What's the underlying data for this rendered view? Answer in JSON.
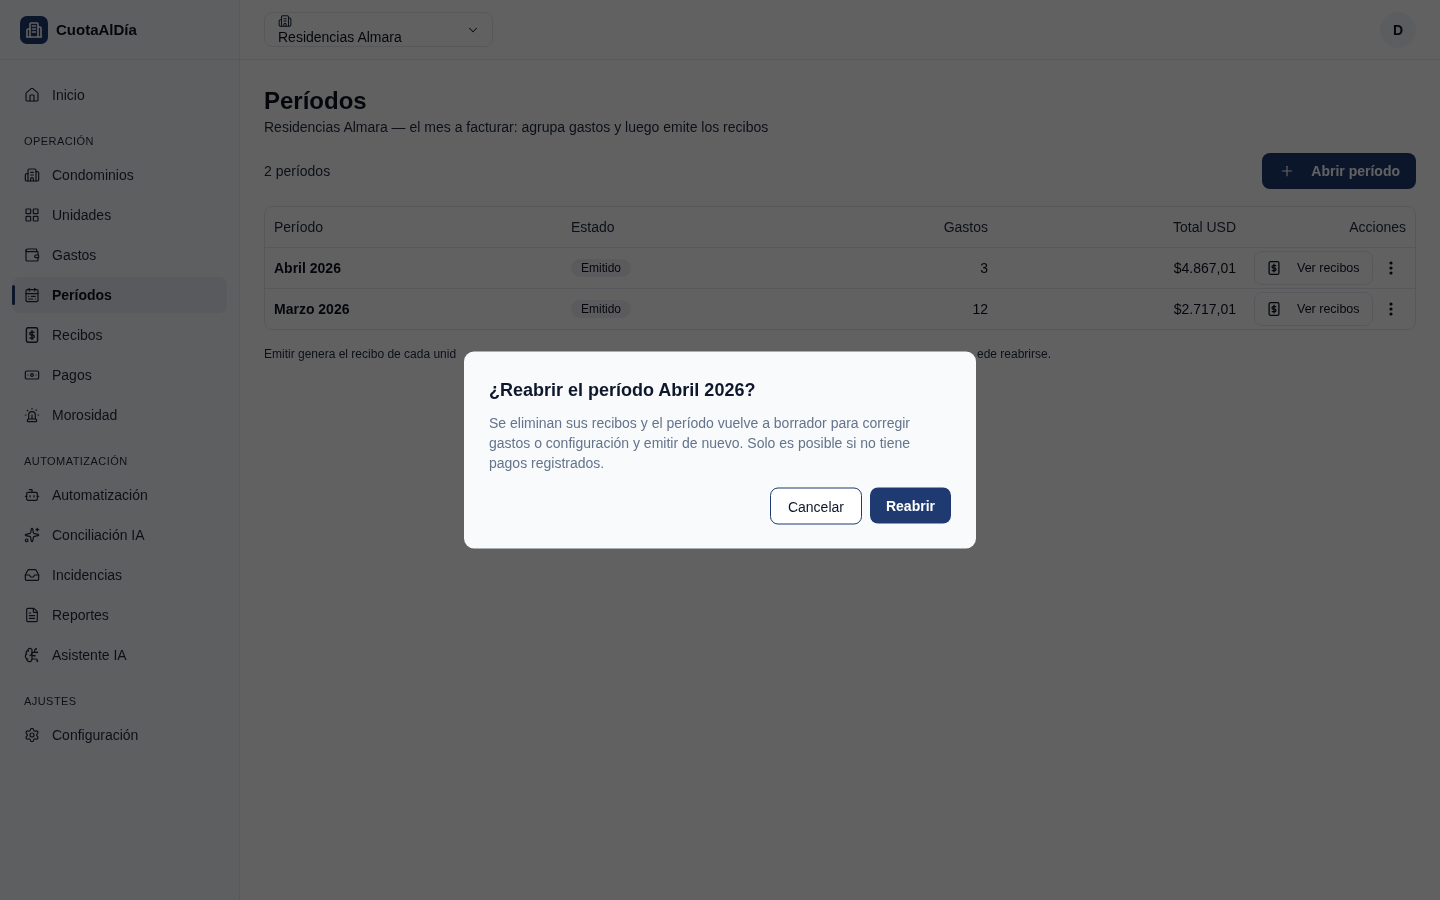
{
  "sidebar": {
    "brand": "CuotaAlDía",
    "sections": [
      {
        "items": [
          {
            "label": "Inicio",
            "selected": false
          }
        ]
      },
      {
        "title": "OPERACIÓN",
        "items": [
          {
            "label": "Condominios",
            "selected": false
          },
          {
            "label": "Unidades",
            "selected": false
          },
          {
            "label": "Gastos",
            "selected": false
          },
          {
            "label": "Períodos",
            "selected": true
          },
          {
            "label": "Recibos",
            "selected": false
          },
          {
            "label": "Pagos",
            "selected": false
          },
          {
            "label": "Morosidad",
            "selected": false
          }
        ]
      },
      {
        "title": "AUTOMATIZACIÓN",
        "items": [
          {
            "label": "Automatización",
            "selected": false
          },
          {
            "label": "Conciliación IA",
            "selected": false
          },
          {
            "label": "Incidencias",
            "selected": false
          },
          {
            "label": "Reportes",
            "selected": false
          },
          {
            "label": "Asistente IA",
            "selected": false
          }
        ]
      },
      {
        "title": "AJUSTES",
        "items": [
          {
            "label": "Configuración",
            "selected": false
          }
        ]
      }
    ]
  },
  "header": {
    "condominium_select": {
      "value": "Residencias Almara"
    },
    "avatar": "D"
  },
  "page": {
    "title": "Períodos",
    "subtitle": "Residencias Almara — el mes a facturar: agrupa gastos y luego emite los recibos",
    "count": "2 períodos",
    "primary_button": "Abrir período"
  },
  "table": {
    "columns": [
      "Período",
      "Estado",
      "Gastos",
      "Total USD",
      "Acciones"
    ],
    "rows": [
      {
        "period": "Abril 2026",
        "status": "Emitido",
        "expenses": "3",
        "total": "$4.867,01",
        "action": "Ver recibos"
      },
      {
        "period": "Marzo 2026",
        "status": "Emitido",
        "expenses": "12",
        "total": "$2.717,01",
        "action": "Ver recibos"
      }
    ]
  },
  "footnote": {
    "visible_start": "Emitir genera el recibo de cada unid",
    "visible_end": "ede reabrirse."
  },
  "dialog": {
    "title": "¿Reabrir el período Abril 2026?",
    "body": "Se eliminan sus recibos y el período vuelve a borrador para corregir gastos o configuración y emitir de nuevo. Solo es posible si no tiene pagos registrados.",
    "buttons": [
      {
        "label": "Cancelar",
        "kind": "secondary"
      },
      {
        "label": "Reabrir",
        "kind": "primary"
      }
    ]
  }
}
